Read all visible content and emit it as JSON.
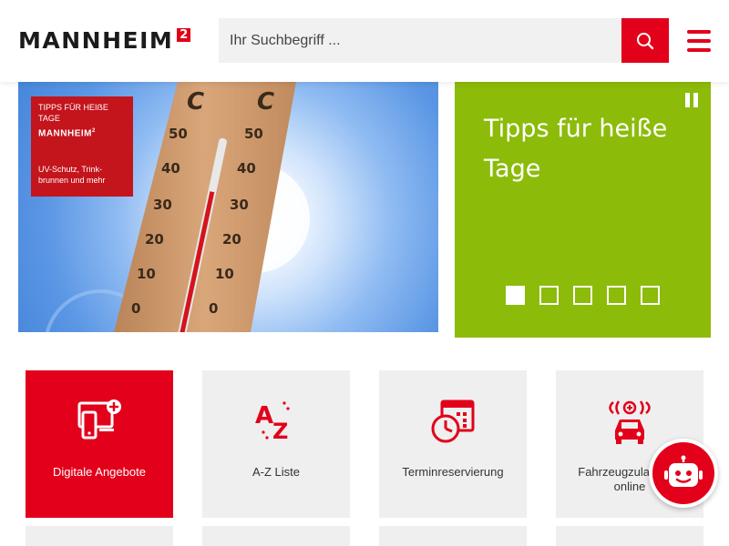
{
  "header": {
    "logo_text": "MANNHEIM",
    "logo_sup": "2",
    "search_placeholder": "Ihr Suchbegriff ..."
  },
  "hero": {
    "promo": {
      "line1": "TIPPS FÜR HEIẞE TAGE",
      "brand": "MANNHEIM",
      "brand_sup": "2",
      "line3": "UV-Schutz, Trink-brunnen und mehr"
    },
    "title": "Tipps für heiße Tage",
    "slides": [
      {
        "label": "1",
        "active": true
      },
      {
        "label": "2",
        "active": false
      },
      {
        "label": "3",
        "active": false
      },
      {
        "label": "4",
        "active": false
      },
      {
        "label": "5",
        "active": false
      }
    ]
  },
  "tiles": [
    {
      "label": "Digitale Angebote",
      "icon": "digital-devices-icon"
    },
    {
      "label": "A-Z Liste",
      "icon": "a-z-icon"
    },
    {
      "label": "Terminreservierung",
      "icon": "calendar-clock-icon"
    },
    {
      "label": "Fahrzeugzulassung online",
      "icon": "car-icon"
    }
  ],
  "colors": {
    "brand_red": "#e2001a",
    "hero_green": "#8cbb0a",
    "tile_grey": "#efefef"
  }
}
